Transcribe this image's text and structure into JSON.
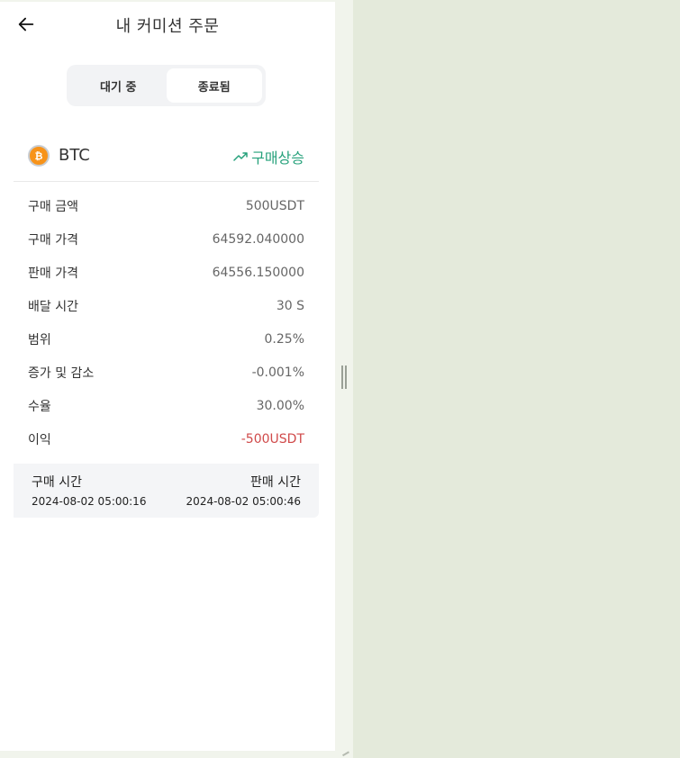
{
  "header": {
    "title": "내 커미션 주문"
  },
  "tabs": [
    {
      "label": "대기 중",
      "active": false
    },
    {
      "label": "종료됨",
      "active": true
    }
  ],
  "order": {
    "coin": "BTC",
    "direction_label": "구매상승",
    "direction_color": "#26a17b",
    "details": [
      {
        "label": "구매 금액",
        "value": "500USDT"
      },
      {
        "label": "구매 가격",
        "value": "64592.040000"
      },
      {
        "label": "판매 가격",
        "value": "64556.150000"
      },
      {
        "label": "배달 시간",
        "value": "30 S"
      },
      {
        "label": "범위",
        "value": "0.25%"
      },
      {
        "label": "증가 및 감소",
        "value": "-0.001%"
      },
      {
        "label": "수율",
        "value": "30.00%"
      },
      {
        "label": "이익",
        "value": "-500USDT"
      }
    ],
    "buy_time_label": "구매 시간",
    "buy_time": "2024-08-02 05:00:16",
    "sell_time_label": "판매 시간",
    "sell_time": "2024-08-02 05:00:46"
  },
  "colors": {
    "loss": "#d04a4a",
    "coin": "#f7931a"
  }
}
